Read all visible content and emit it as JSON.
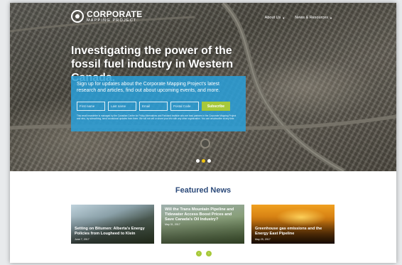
{
  "header": {
    "logo_line1": "CORPORATE",
    "logo_line2": "MAPPING PROJECT",
    "nav": [
      {
        "label": "About Us"
      },
      {
        "label": "News & Resources"
      }
    ]
  },
  "hero": {
    "headline": "Investigating the power of the fossil fuel industry in Western Canada.",
    "signup_text": "Sign up for updates about the Corporate Mapping Project's latest research and articles, find out about upcoming events, and more.",
    "fields": {
      "first_name": "First name",
      "last_name": "Last name",
      "email": "Email",
      "postal_code": "Postal Code"
    },
    "subscribe_label": "Subscribe",
    "disclaimer": "This email newsletter is managed by the Canadian Centre for Policy Alternatives and Parkland Institute who are lead partners in the Corporate Mapping Project and who, by subscribing, send occasional updates from them. We will not sell or share your info with any other organization. You can unsubscribe at any time.",
    "slide_count": 3,
    "active_slide": 2
  },
  "featured": {
    "title": "Featured News",
    "cards": [
      {
        "title": "Setting on Bitumen: Alberta's Energy Policies from Lougheed to Klein",
        "date": "June 7, 2017"
      },
      {
        "title": "Will the Trans Mountain Pipeline and Tidewater Access Boost Prices and Save Canada's Oil Industry?",
        "date": "May 31, 2017"
      },
      {
        "title": "Greenhouse gas emissions and the Energy East Pipeline",
        "date": "May 25, 2017"
      }
    ],
    "prev_icon": "chevron-left-icon",
    "next_icon": "chevron-right-icon"
  },
  "colors": {
    "accent_blue": "#29a0db",
    "accent_green": "#a7c93a",
    "title_navy": "#2c4a7a"
  }
}
